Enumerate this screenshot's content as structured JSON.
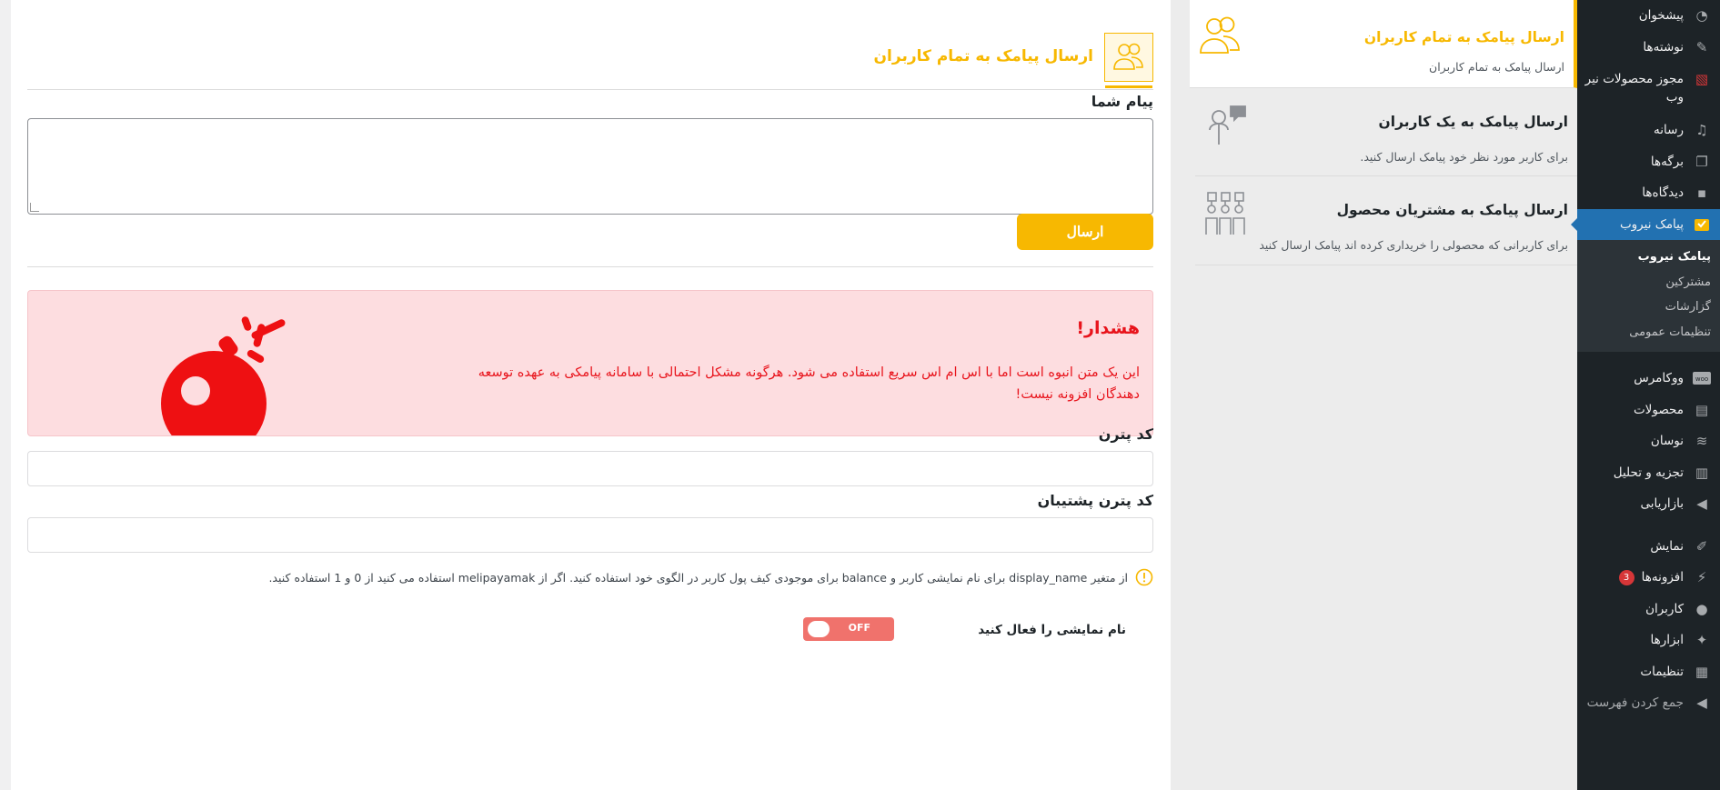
{
  "admin_menu": {
    "items": [
      {
        "label": "پیشخوان",
        "icon": "dashboard-icon"
      },
      {
        "label": "نوشته‌ها",
        "icon": "pin-icon"
      },
      {
        "label": "مجوز محصولات نیر وب",
        "icon": "license-icon"
      },
      {
        "label": "رسانه",
        "icon": "media-icon"
      },
      {
        "label": "برگه‌ها",
        "icon": "pages-icon"
      },
      {
        "label": "دیدگاه‌ها",
        "icon": "comments-icon"
      },
      {
        "label": "پیامک نیروب",
        "icon": "sms-icon"
      },
      {
        "label": "ووکامرس",
        "icon": "woo-icon"
      },
      {
        "label": "محصولات",
        "icon": "archive-icon"
      },
      {
        "label": "نوسان",
        "icon": "wave-icon"
      },
      {
        "label": "تجزیه و تحلیل",
        "icon": "chart-icon"
      },
      {
        "label": "بازاریابی",
        "icon": "megaphone-icon"
      },
      {
        "label": "نمایش",
        "icon": "brush-icon"
      },
      {
        "label": "افزونه‌ها",
        "icon": "plugin-icon",
        "badge": "3"
      },
      {
        "label": "کاربران",
        "icon": "user-icon"
      },
      {
        "label": "ابزارها",
        "icon": "wrench-icon"
      },
      {
        "label": "تنظیمات",
        "icon": "settings-icon"
      }
    ],
    "submenu": [
      "پیامک نیروب",
      "مشترکین",
      "گزارشات",
      "تنظیمات عمومی"
    ],
    "collapse_label": "جمع کردن فهرست"
  },
  "tabs": [
    {
      "title": "ارسال پیامک به تمام کاربران",
      "desc": "ارسال پیامک به تمام کاربران",
      "icon": "users-group-icon"
    },
    {
      "title": "ارسال پیامک به یک کاربران",
      "desc": "برای کاربر مورد نظر خود پیامک ارسال کنید.",
      "icon": "user-chat-icon"
    },
    {
      "title": "ارسال پیامک به مشتریان محصول",
      "desc": "برای کاربرانی که محصولی را خریداری کرده اند پیامک ارسال کنید",
      "icon": "customers-icon"
    }
  ],
  "main": {
    "page_title": "ارسال پیامک به تمام کاربران",
    "message_label": "پیام شما",
    "send_label": "ارسال",
    "warning": {
      "title": "هشدار!",
      "text": "این یک متن انبوه است اما با اس ام اس سریع استفاده می شود. هرگونه مشکل احتمالی با سامانه پیامکی به عهده توسعه دهندگان افزونه نیست!"
    },
    "pattern_label": "کد پترن",
    "backup_pattern_label": "کد پترن پشتیبان",
    "note": "از متغیر display_name برای نام نمایشی کاربر و balance برای موجودی کیف پول کاربر در الگوی خود استفاده کنید. اگر از melipayamak استفاده می کنید از 0 و 1 استفاده کنید.",
    "toggle_label": "نام نمایشی را فعال کنید",
    "toggle_state": "OFF"
  },
  "colors": {
    "accent": "#f7b801",
    "danger": "#e8141c",
    "admin_bg": "#1d2327",
    "admin_active": "#2271b1"
  }
}
